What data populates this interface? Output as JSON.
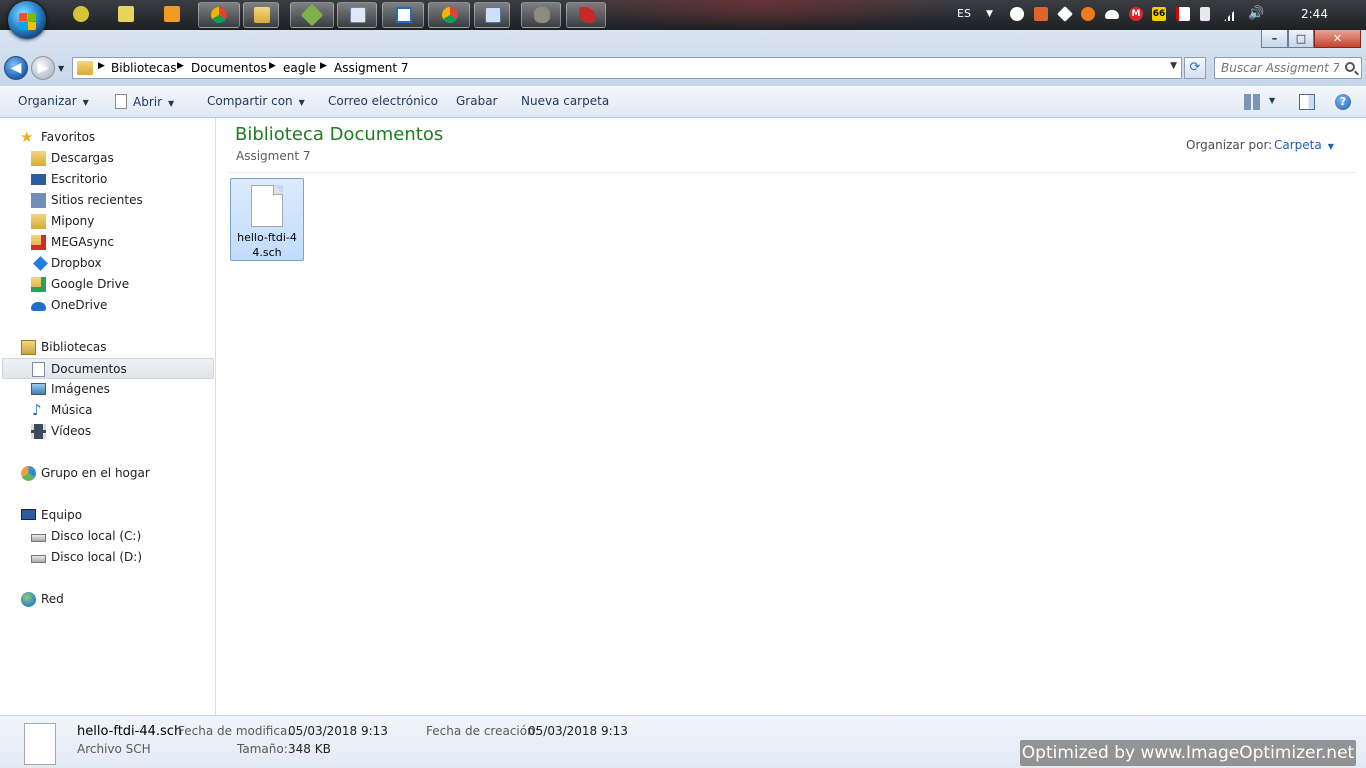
{
  "taskbar": {
    "language": "ES",
    "clock": "2:44",
    "badge_66": "66",
    "badge_m": "M"
  },
  "window": {
    "minimize": "–",
    "maximize": "□",
    "close": "✕"
  },
  "address_bar": {
    "breadcrumbs": [
      "Bibliotecas",
      "Documentos",
      "eagle",
      "Assigment 7"
    ],
    "search_placeholder": "Buscar Assigment 7"
  },
  "command_bar": {
    "organize": "Organizar",
    "open": "Abrir",
    "share": "Compartir con",
    "email": "Correo electrónico",
    "burn": "Grabar",
    "new_folder": "Nueva carpeta"
  },
  "nav_pane": {
    "favorites": {
      "label": "Favoritos",
      "items": [
        "Descargas",
        "Escritorio",
        "Sitios recientes",
        "Mipony",
        "MEGAsync",
        "Dropbox",
        "Google Drive",
        "OneDrive"
      ]
    },
    "libraries": {
      "label": "Bibliotecas",
      "items": [
        "Documentos",
        "Imágenes",
        "Música",
        "Vídeos"
      ]
    },
    "homegroup": "Grupo en el hogar",
    "computer": {
      "label": "Equipo",
      "items": [
        "Disco local (C:)",
        "Disco local (D:)"
      ]
    },
    "network": "Red"
  },
  "content": {
    "title": "Biblioteca Documentos",
    "subtitle": "Assigment 7",
    "arrange_label": "Organizar por:",
    "arrange_value": "Carpeta",
    "files": [
      {
        "name": "hello-ftdi-44.sch"
      }
    ]
  },
  "details": {
    "filename": "hello-ftdi-44.sch",
    "type": "Archivo SCH",
    "modified_label": "Fecha de modifica...",
    "modified_value": "05/03/2018 9:13",
    "size_label": "Tamaño:",
    "size_value": "348 KB",
    "created_label": "Fecha de creación:",
    "created_value": "05/03/2018 9:13"
  },
  "watermark": "Optimized by www.ImageOptimizer.net",
  "colors": {
    "title_green": "#1e7d1e",
    "link_blue": "#1e5fb8",
    "selection": "#c1dcfc"
  }
}
